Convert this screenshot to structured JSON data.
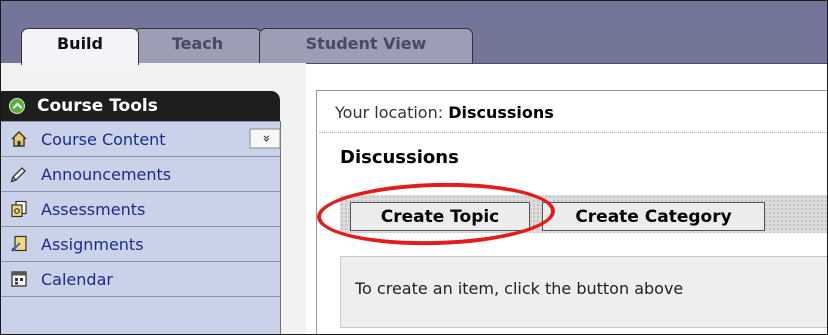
{
  "tabs": [
    {
      "label": "Build",
      "active": true
    },
    {
      "label": "Teach",
      "active": false
    },
    {
      "label": "Student View",
      "active": false
    }
  ],
  "sidebar": {
    "header": "Course Tools",
    "items": [
      {
        "label": "Course Content",
        "icon": "house-icon"
      },
      {
        "label": "Announcements",
        "icon": "megaphone-icon"
      },
      {
        "label": "Assessments",
        "icon": "assessment-icon"
      },
      {
        "label": "Assignments",
        "icon": "assignment-icon"
      },
      {
        "label": "Calendar",
        "icon": "calendar-icon"
      }
    ],
    "expander_symbol": "»"
  },
  "main": {
    "location_prefix": "Your location:",
    "location": "Discussions",
    "title": "Discussions",
    "buttons": {
      "create_topic": "Create Topic",
      "create_category": "Create Category"
    },
    "info_text": "To create an item, click the button above"
  },
  "colors": {
    "tabbar": "#737599",
    "sidebar_list": "#c9d2e9",
    "highlight_ellipse": "#e31b1b",
    "link_text": "#1e2a8a"
  }
}
